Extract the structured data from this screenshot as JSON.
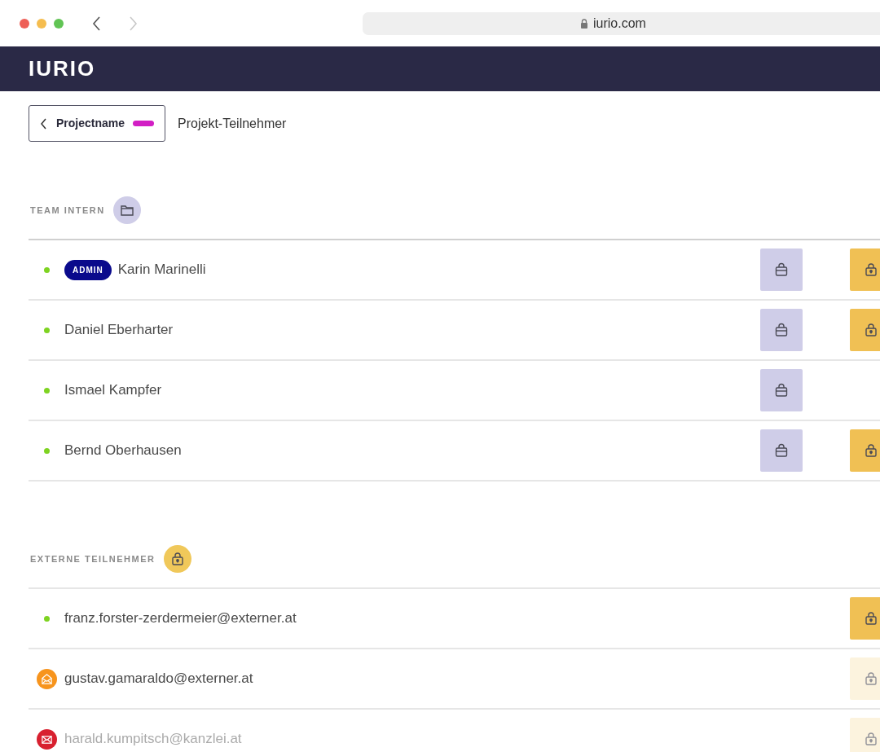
{
  "browser": {
    "url": "iurio.com"
  },
  "header": {
    "logo": "IURIO"
  },
  "breadcrumb": {
    "back_label": "Projectname",
    "title": "Projekt-Teilnehmer"
  },
  "sections": [
    {
      "title": "TEAM INTERN",
      "kind": "team",
      "rows": [
        {
          "online": true,
          "badge": "ADMIN",
          "name": "Karin Marinelli",
          "team_access": true,
          "extern_access": true,
          "extern_disabled": false
        },
        {
          "online": true,
          "name": "Daniel Eberharter",
          "team_access": true,
          "extern_access": true,
          "extern_disabled": false
        },
        {
          "online": true,
          "name": "Ismael Kampfer",
          "team_access": true,
          "extern_access": false
        },
        {
          "online": true,
          "name": "Bernd Oberhausen",
          "team_access": true,
          "extern_access": true,
          "extern_disabled": false
        }
      ]
    },
    {
      "title": "EXTERNE TEILNEHMER",
      "kind": "extern",
      "rows": [
        {
          "online": true,
          "name": "franz.forster-zerdermeier@externer.at",
          "extern_access": true,
          "extern_disabled": false
        },
        {
          "online": false,
          "invitation_opened": true,
          "name": "gustav.gamaraldo@externer.at",
          "extern_access": true,
          "extern_disabled": true
        },
        {
          "online": false,
          "invitation_opened": false,
          "name": "harald.kumpitsch@kanzlei.at",
          "extern_access": true,
          "extern_disabled": true
        }
      ]
    }
  ]
}
